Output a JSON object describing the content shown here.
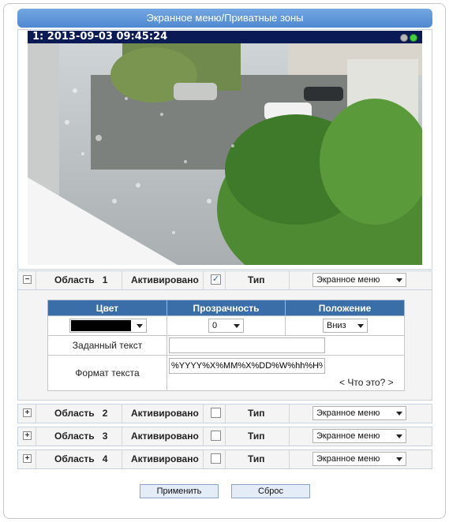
{
  "header": {
    "title": "Экранное меню/Приватные зоны"
  },
  "video": {
    "osd_text": "1:  2013-09-03 09:45:24"
  },
  "area_label": "Область",
  "activated_label": "Активировано",
  "type_label": "Тип",
  "areas": [
    {
      "number": "1",
      "expanded": true,
      "activated": true,
      "type": "Экранное меню"
    },
    {
      "number": "2",
      "expanded": false,
      "activated": false,
      "type": "Экранное меню"
    },
    {
      "number": "3",
      "expanded": false,
      "activated": false,
      "type": "Экранное меню"
    },
    {
      "number": "4",
      "expanded": false,
      "activated": false,
      "type": "Экранное меню"
    }
  ],
  "details": {
    "col_color": "Цвет",
    "col_transparency": "Прозрачность",
    "col_position": "Положение",
    "color_value": "#000000",
    "transparency_value": "0",
    "position_value": "Вниз",
    "preset_text_label": "Заданный текст",
    "preset_text_value": "",
    "format_label": "Формат текста",
    "format_value": "%YYYY%X%MM%X%DD%W%hh%H%",
    "help_link": "< Что это? >"
  },
  "buttons": {
    "apply": "Применить",
    "reset": "Сброс"
  }
}
